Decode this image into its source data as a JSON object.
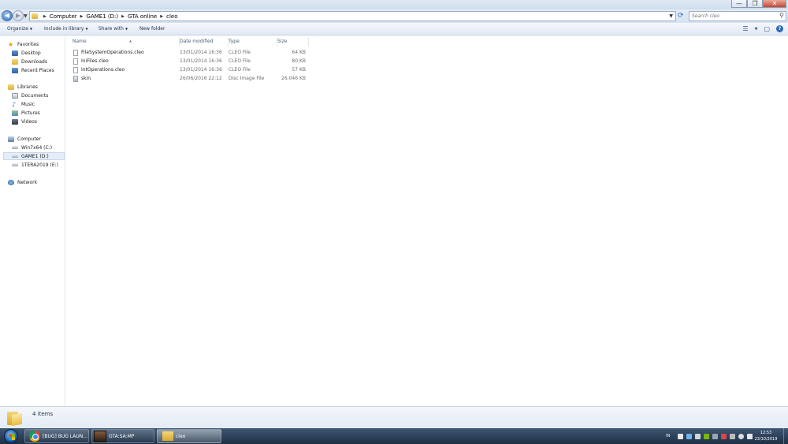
{
  "window": {
    "controls": {
      "minimize": "—",
      "maximize": "❐",
      "close": "✕"
    }
  },
  "address": {
    "crumbs": [
      "Computer",
      "GAME1 (D:)",
      "GTA online",
      "cleo"
    ]
  },
  "search": {
    "placeholder": "Search cleo"
  },
  "toolbar": {
    "organize": "Organize",
    "include": "Include in library",
    "share": "Share with",
    "newfolder": "New folder"
  },
  "nav": {
    "favorites": "Favorites",
    "desktop": "Desktop",
    "downloads": "Downloads",
    "recent": "Recent Places",
    "libraries": "Libraries",
    "documents": "Documents",
    "music": "Music",
    "pictures": "Pictures",
    "videos": "Videos",
    "computer": "Computer",
    "drive_c": "Win7x64 (C:)",
    "drive_d": "GAME1 (D:)",
    "drive_e": "1TERA2019 (E:)",
    "network": "Network"
  },
  "columns": {
    "name": "Name",
    "date": "Date modified",
    "type": "Type",
    "size": "Size"
  },
  "files": [
    {
      "name": "FileSystemOperations.cleo",
      "date": "13/01/2014 16:36",
      "type": "CLEO File",
      "size": "64 KB"
    },
    {
      "name": "IniFiles.cleo",
      "date": "13/01/2014 16:36",
      "type": "CLEO File",
      "size": "80 KB"
    },
    {
      "name": "IntOperations.cleo",
      "date": "13/01/2014 16:36",
      "type": "CLEO File",
      "size": "57 KB"
    },
    {
      "name": "skin",
      "date": "26/06/2016 22:12",
      "type": "Disc Image File",
      "size": "26.046 KB"
    }
  ],
  "status": {
    "count": "4 items"
  },
  "taskbar": {
    "tasks": [
      {
        "label": "[BUG] BUG LAUN..."
      },
      {
        "label": "GTA:SA:MP"
      },
      {
        "label": "cleo"
      }
    ],
    "lang": "IN",
    "time": "12:53",
    "date": "23/10/2019"
  }
}
